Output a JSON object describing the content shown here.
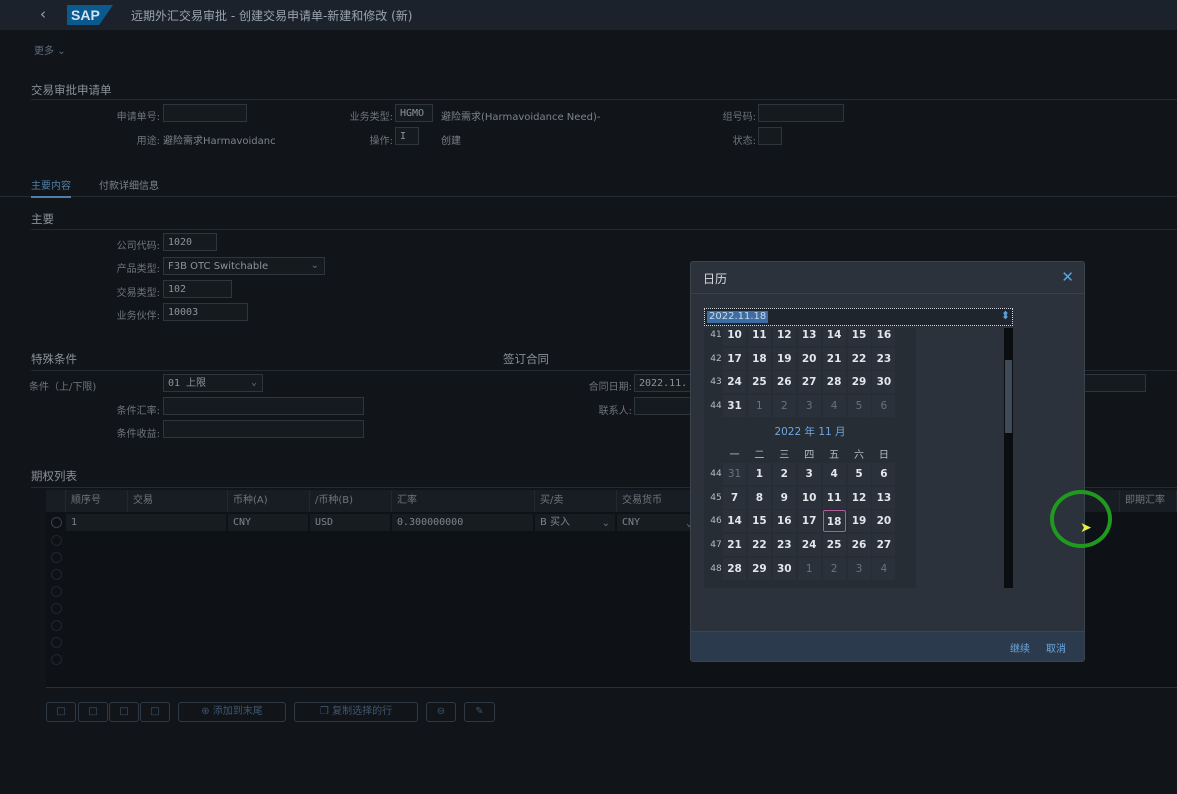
{
  "header": {
    "back_icon": "chevron-left-icon",
    "logo": "SAP",
    "title": "远期外汇交易审批 - 创建交易申请单-新建和修改 (新)",
    "more": "更多"
  },
  "request": {
    "section_title": "交易审批申请单",
    "request_no_label": "申请单号:",
    "request_no": "",
    "biz_type_label": "业务类型:",
    "biz_type": "HGMO",
    "biz_type_desc": "避险需求(Harmavoidance Need)-",
    "group_no_label": "组号码:",
    "group_no": "",
    "purpose_label": "用途:",
    "purpose": "避险需求Harmavoidanc",
    "operation_label": "操作:",
    "operation": "I",
    "operation_desc": "创建",
    "status_label": "状态:",
    "status": ""
  },
  "tabs": [
    {
      "label": "主要内容",
      "active": true
    },
    {
      "label": "付款详细信息",
      "active": false
    }
  ],
  "main": {
    "section_title": "主要",
    "company_label": "公司代码:",
    "company": "1020",
    "product_label": "产品类型:",
    "product": "F3B OTC Switchable",
    "trade_type_label": "交易类型:",
    "trade_type": "102",
    "partner_label": "业务伙伴:",
    "partner": "10003"
  },
  "conditions": {
    "section_title": "特殊条件",
    "cond_label": "条件（上/下限)",
    "cond": "01 上限",
    "rate_label": "条件汇率:",
    "rate": "",
    "yield_label": "条件收益:",
    "yield": ""
  },
  "contract": {
    "section_title": "签订合同",
    "date_label": "合同日期:",
    "date": "2022.11.",
    "contact_label": "联系人:",
    "contact": ""
  },
  "options": {
    "section_title": "期权列表",
    "columns": [
      "顺序号",
      "交易",
      "币种(A)",
      "/币种(B)",
      "汇率",
      "买/卖",
      "交易货币",
      "即期汇率"
    ],
    "rows": [
      {
        "seq": "1",
        "trade": "",
        "ccy_a": "CNY",
        "ccy_b": "USD",
        "rate": "0.300000000",
        "buy_sell": "B 买入",
        "trade_ccy": "CNY"
      }
    ],
    "buttons": {
      "add_end": "添加到末尾",
      "copy_rows": "复制选择的行"
    }
  },
  "calendar": {
    "title": "日历",
    "value": "2022.11.18",
    "continue": "继续",
    "cancel": "取消",
    "oct_rows": [
      {
        "week": "41",
        "days": [
          "10",
          "11",
          "12",
          "13",
          "14",
          "15",
          "16"
        ],
        "muted": []
      },
      {
        "week": "42",
        "days": [
          "17",
          "18",
          "19",
          "20",
          "21",
          "22",
          "23"
        ],
        "muted": []
      },
      {
        "week": "43",
        "days": [
          "24",
          "25",
          "26",
          "27",
          "28",
          "29",
          "30"
        ],
        "muted": []
      },
      {
        "week": "44",
        "days": [
          "31",
          "1",
          "2",
          "3",
          "4",
          "5",
          "6"
        ],
        "muted": [
          1,
          2,
          3,
          4,
          5,
          6
        ]
      }
    ],
    "month_title": "2022 年 11 月",
    "weekdays": [
      "一",
      "二",
      "三",
      "四",
      "五",
      "六",
      "日"
    ],
    "nov_rows": [
      {
        "week": "44",
        "days": [
          "31",
          "1",
          "2",
          "3",
          "4",
          "5",
          "6"
        ],
        "muted": [
          0
        ]
      },
      {
        "week": "45",
        "days": [
          "7",
          "8",
          "9",
          "10",
          "11",
          "12",
          "13"
        ],
        "muted": []
      },
      {
        "week": "46",
        "days": [
          "14",
          "15",
          "16",
          "17",
          "18",
          "19",
          "20"
        ],
        "muted": []
      },
      {
        "week": "47",
        "days": [
          "21",
          "22",
          "23",
          "24",
          "25",
          "26",
          "27"
        ],
        "muted": []
      },
      {
        "week": "48",
        "days": [
          "28",
          "29",
          "30",
          "1",
          "2",
          "3",
          "4"
        ],
        "muted": [
          3,
          4,
          5,
          6
        ]
      }
    ],
    "selected": "18"
  }
}
